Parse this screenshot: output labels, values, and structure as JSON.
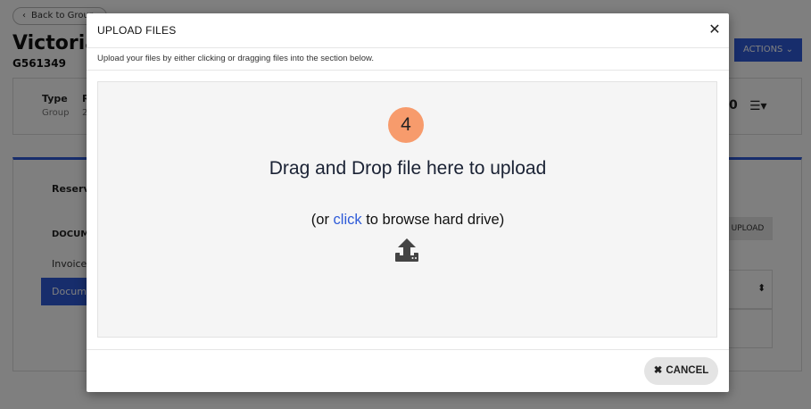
{
  "background": {
    "back_label": "Back to Group",
    "page_title": "Victoria",
    "page_code": "G561349",
    "actions_label": "ACTIONS",
    "type_label": "Type",
    "type_value": "Group",
    "r_label": "R",
    "r_value": "2",
    "num_fragment": "0",
    "reservations_label": "Reserv",
    "documents_heading": "DOCUM",
    "invoices_label": "Invoices",
    "documents_label": "Docum",
    "upload_label": "UPLOAD",
    "icons": {
      "back": "chevron-left-icon",
      "actions": "chevron-down-icon",
      "menu": "hamburger-menu-icon",
      "sort": "sort-icon"
    }
  },
  "modal": {
    "title": "UPLOAD FILES",
    "subtitle": "Upload your files by either clicking or dragging files into the section below.",
    "step_number": "4",
    "dropzone_title": "Drag and Drop file here to upload",
    "dropzone_sub_prefix": "(or ",
    "dropzone_sub_link": "click",
    "dropzone_sub_suffix": " to browse hard drive)",
    "cancel_label": "CANCEL",
    "icons": {
      "close": "close-icon",
      "upload": "upload-icon",
      "cancel": "close-icon"
    },
    "colors": {
      "badge": "#f79b6c",
      "link": "#2e5bd8",
      "accent": "#2e5bd8"
    }
  }
}
